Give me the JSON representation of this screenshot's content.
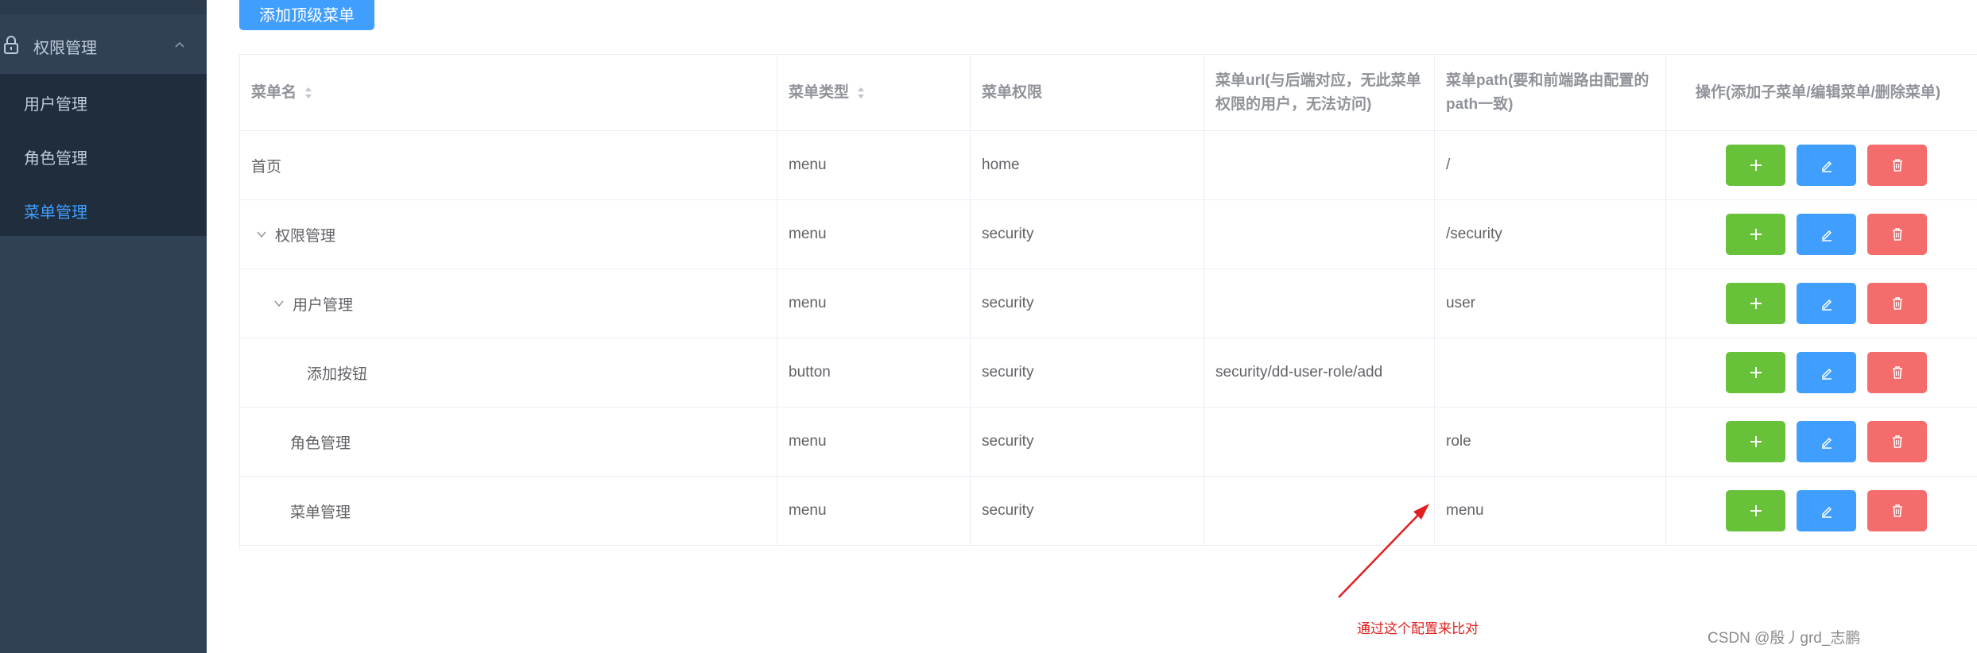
{
  "sidebar": {
    "group_title": "权限管理",
    "items": [
      {
        "label": "用户管理",
        "active": false
      },
      {
        "label": "角色管理",
        "active": false
      },
      {
        "label": "菜单管理",
        "active": true
      }
    ]
  },
  "toolbar": {
    "add_top_label": "添加顶级菜单"
  },
  "table": {
    "headers": {
      "name": "菜单名",
      "type": "菜单类型",
      "perm": "菜单权限",
      "url": "菜单url(与后端对应，无此菜单权限的用户，无法访问)",
      "path": "菜单path(要和前端路由配置的path一致)",
      "ops": "操作(添加子菜单/编辑菜单/删除菜单)"
    },
    "rows": [
      {
        "name": "首页",
        "type": "menu",
        "perm": "home",
        "url": "",
        "path": "/"
      },
      {
        "name": "权限管理",
        "type": "menu",
        "perm": "security",
        "url": "",
        "path": "/security"
      },
      {
        "name": "用户管理",
        "type": "menu",
        "perm": "security",
        "url": "",
        "path": "user"
      },
      {
        "name": "添加按钮",
        "type": "button",
        "perm": "security",
        "url": "security/dd-user-role/add",
        "path": ""
      },
      {
        "name": "角色管理",
        "type": "menu",
        "perm": "security",
        "url": "",
        "path": "role"
      },
      {
        "name": "菜单管理",
        "type": "menu",
        "perm": "security",
        "url": "",
        "path": "menu"
      }
    ]
  },
  "annotation": {
    "text": "通过这个配置来比对",
    "color": "#e02020"
  },
  "watermark": "CSDN @殷丿grd_志鹏",
  "colors": {
    "sidebar_bg": "#304156",
    "submenu_bg": "#1f2d3d",
    "primary": "#409eff",
    "success": "#67c23a",
    "danger": "#f56c6c"
  }
}
